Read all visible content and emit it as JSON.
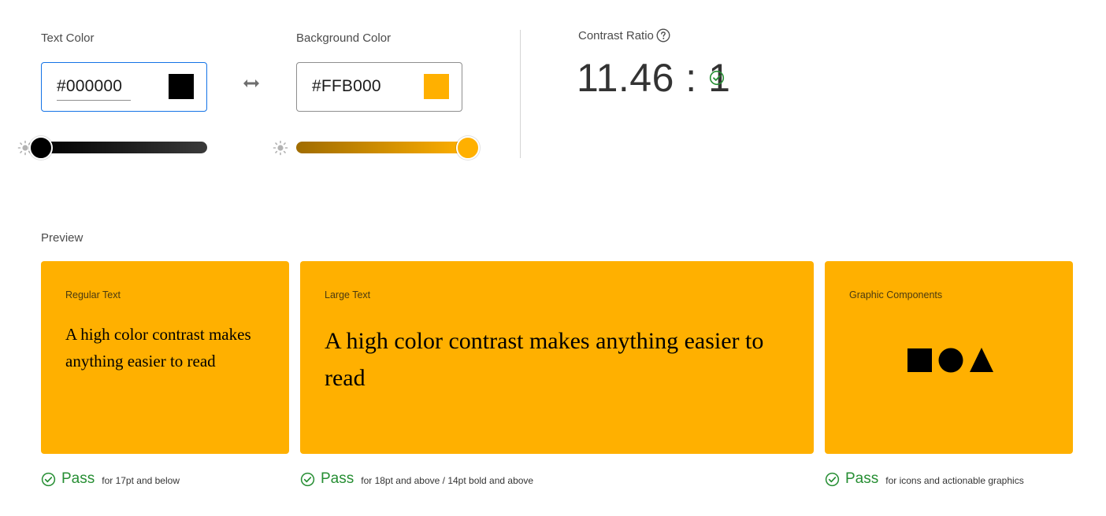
{
  "text_color": {
    "label": "Text Color",
    "value": "#000000",
    "swatch": "#000000",
    "lightness_slider": 0.0,
    "slider_icon": "sun-icon"
  },
  "swap": {
    "icon": "swap-arrows-icon"
  },
  "background_color": {
    "label": "Background Color",
    "value": "#FFB000",
    "swatch": "#FFB000",
    "lightness_slider": 1.0,
    "slider_icon": "sun-icon"
  },
  "contrast": {
    "label": "Contrast Ratio",
    "help_icon": "question-icon",
    "value": "11.46 : 1",
    "status_icon": "check-circle-icon"
  },
  "preview": {
    "label": "Preview",
    "cards": [
      {
        "title": "Regular Text",
        "sample": "A high color contrast makes anything easier to read"
      },
      {
        "title": "Large Text",
        "sample": "A high color contrast makes anything easier to read"
      },
      {
        "title": "Graphic Components",
        "shapes": [
          "square",
          "circle",
          "triangle"
        ]
      }
    ],
    "results": [
      {
        "status": "Pass",
        "description": "for 17pt and below"
      },
      {
        "status": "Pass",
        "description": "for 18pt and above / 14pt bold and above"
      },
      {
        "status": "Pass",
        "description": "for icons and actionable graphics"
      }
    ]
  },
  "colors": {
    "accent_focus": "#1473E6",
    "pass_green": "#268E33",
    "preview_background": "#FFB000",
    "preview_foreground": "#000000"
  }
}
